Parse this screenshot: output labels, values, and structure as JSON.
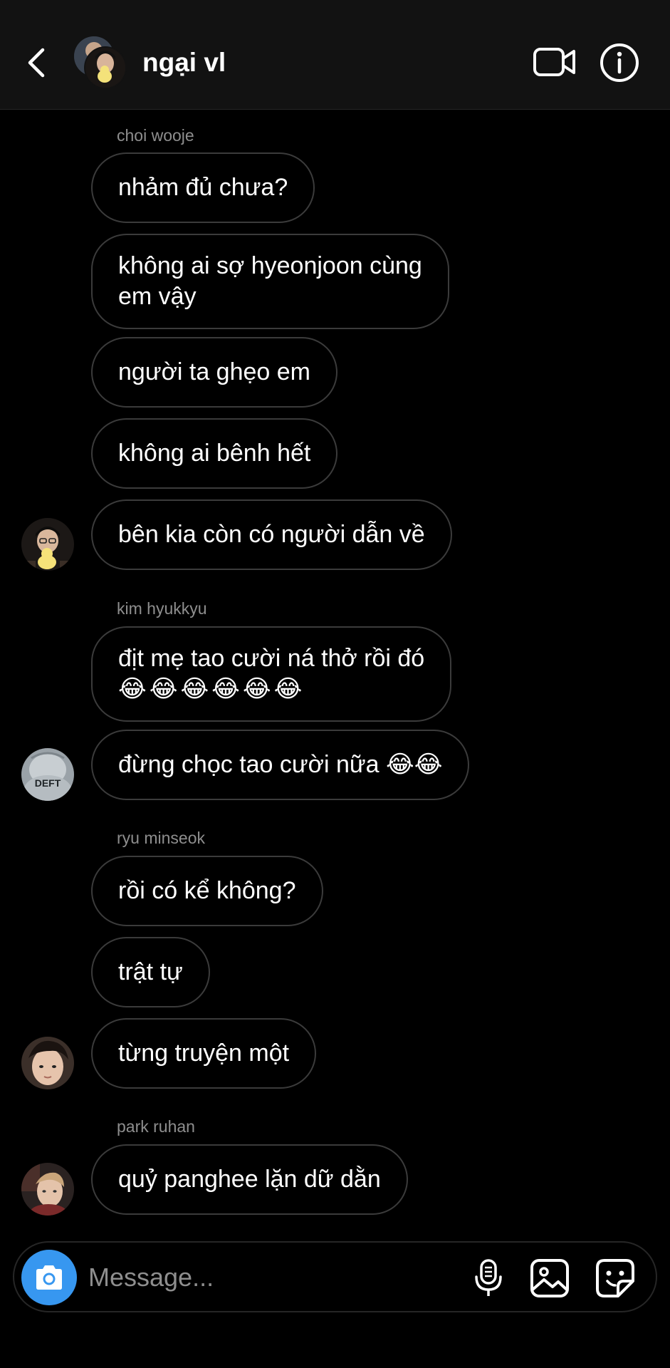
{
  "header": {
    "title": "ngại vl"
  },
  "messages": [
    {
      "sender": "choi wooje"
    },
    {
      "text": "nhảm đủ chưa?"
    },
    {
      "text_line1": "không ai sợ hyeonjoon cùng",
      "text_line2": "em vậy"
    },
    {
      "text": "người ta ghẹo em"
    },
    {
      "text": "không ai bênh hết"
    },
    {
      "text": "bên kia còn có người dẫn về"
    },
    {
      "sender": "kim hyukkyu"
    },
    {
      "text_line1": "địt mẹ tao cười ná thở rồi đó",
      "text_line2": "😂😂😂😂😂😂"
    },
    {
      "text": "đừng chọc tao cười nữa 😂😂"
    },
    {
      "sender": "ryu minseok"
    },
    {
      "text": "rồi có kể không?"
    },
    {
      "text": "trật tự"
    },
    {
      "text": "từng truyện một"
    },
    {
      "sender": "park ruhan"
    },
    {
      "text": "quỷ panghee lặn dữ dằn"
    }
  ],
  "avatars": {
    "deft_label": "DEFT"
  },
  "composer": {
    "placeholder": "Message..."
  },
  "colors": {
    "header_bg": "#121212",
    "bubble_border": "#3b3b3b",
    "camera_button": "#3797f0",
    "secondary_text": "#8e8e8e"
  }
}
